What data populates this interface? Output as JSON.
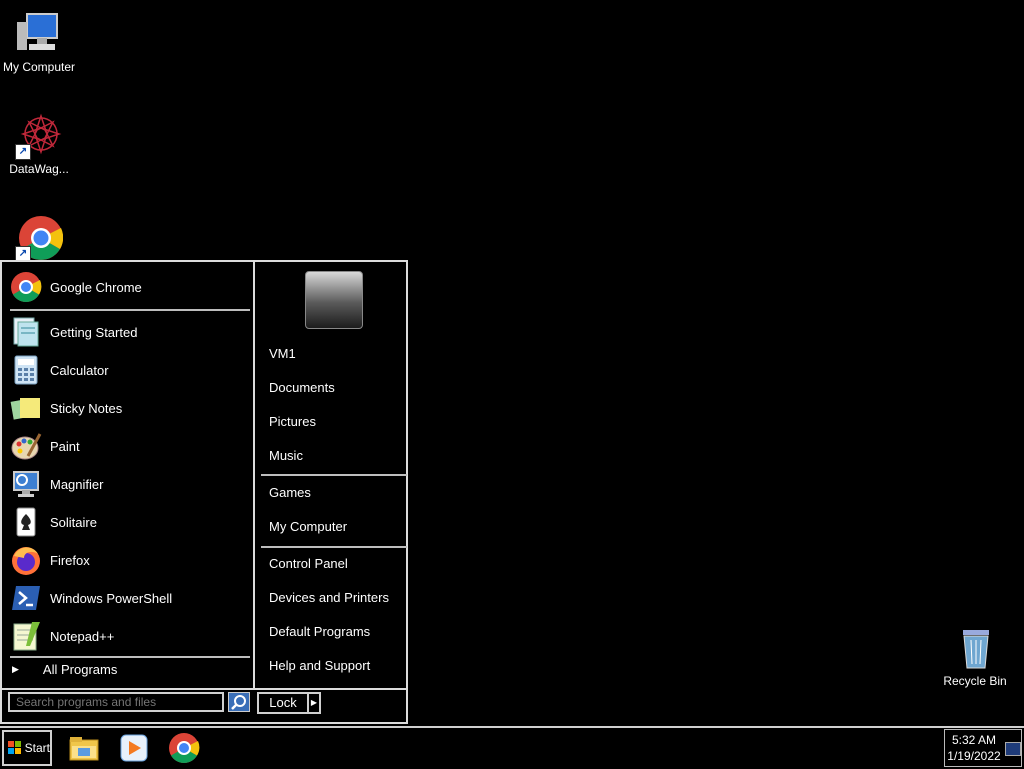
{
  "desktop": {
    "icons": [
      {
        "label": "My Computer",
        "icon": "computer-icon"
      },
      {
        "label": "DataWag...",
        "icon": "datawag-icon"
      },
      {
        "label": "",
        "icon": "chrome-icon"
      },
      {
        "label": "Recycle Bin",
        "icon": "recycle-bin-icon"
      }
    ]
  },
  "start_menu": {
    "pinned": [
      {
        "label": "Google Chrome",
        "icon": "chrome-icon"
      }
    ],
    "recent": [
      {
        "label": "Getting Started",
        "icon": "getting-started-icon"
      },
      {
        "label": "Calculator",
        "icon": "calculator-icon"
      },
      {
        "label": "Sticky Notes",
        "icon": "sticky-notes-icon"
      },
      {
        "label": "Paint",
        "icon": "paint-icon"
      },
      {
        "label": "Magnifier",
        "icon": "magnifier-icon"
      },
      {
        "label": "Solitaire",
        "icon": "solitaire-icon"
      },
      {
        "label": "Firefox",
        "icon": "firefox-icon"
      },
      {
        "label": "Windows PowerShell",
        "icon": "powershell-icon"
      },
      {
        "label": "Notepad++",
        "icon": "notepadpp-icon"
      }
    ],
    "all_programs": "All Programs",
    "places_1": [
      "VM1",
      "Documents",
      "Pictures",
      "Music"
    ],
    "places_2": [
      "Games",
      "My Computer"
    ],
    "places_3": [
      "Control Panel",
      "Devices and Printers",
      "Default Programs",
      "Help and Support"
    ],
    "search_placeholder": "Search programs and files",
    "lock_label": "Lock"
  },
  "taskbar": {
    "start_label": "Start",
    "apps": [
      "file-explorer-icon",
      "media-player-icon",
      "chrome-icon"
    ],
    "clock_time": "5:32 AM",
    "clock_date": "1/19/2022"
  },
  "colors": {
    "accent": "#3a6fb8",
    "border": "#dcdcdc"
  }
}
